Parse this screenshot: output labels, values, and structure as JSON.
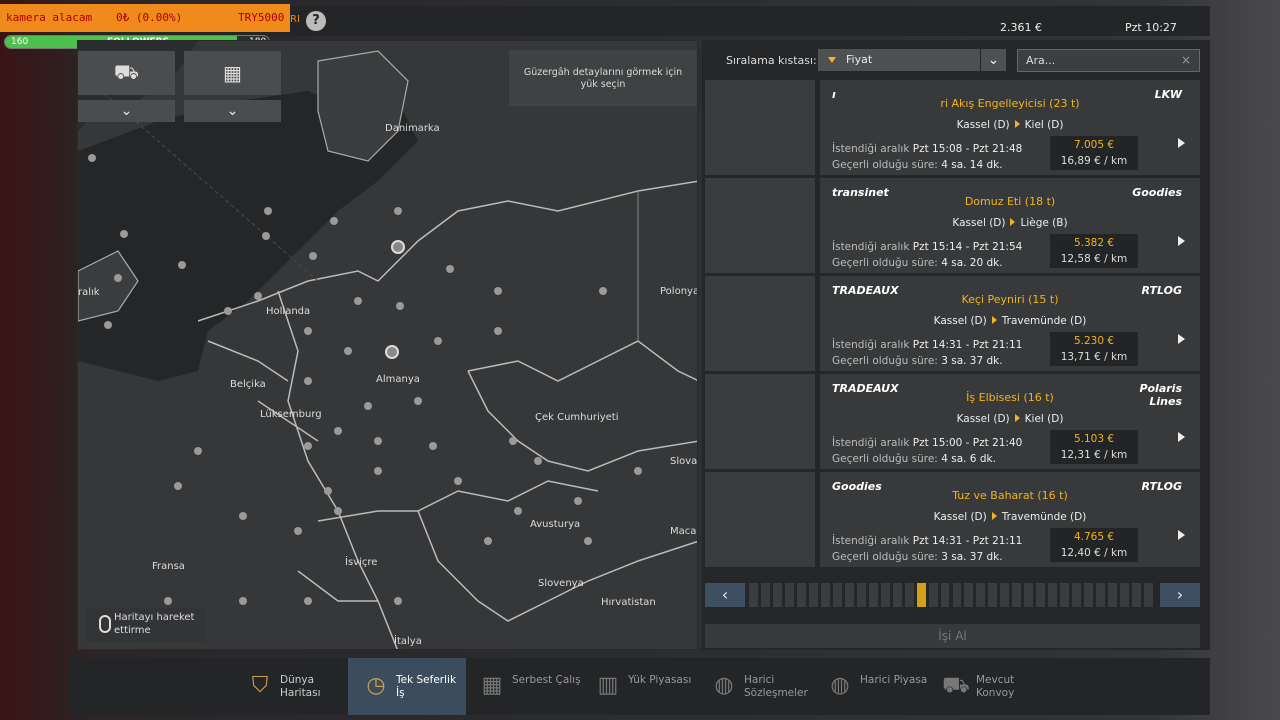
{
  "overlay": {
    "streamer_left": "kamera alacam",
    "streamer_mid": "0₺ (0.00%)",
    "streamer_right": "TRY5000",
    "streamer_suffix": "RI",
    "followers_label": "FOLLOWERS",
    "followers_current": "160",
    "followers_goal": "180",
    "followers_progress": 0.88
  },
  "topbar": {
    "help": "?",
    "money": "2.361 €",
    "clock": "Pzt 10:27"
  },
  "map": {
    "route_hint": "Güzergâh detaylarını görmek için yük seçin",
    "move_hint": "Haritayı hareket ettirme",
    "labels": [
      "Danimarka",
      "ralık",
      "Hollanda",
      "Polonya",
      "Almanya",
      "Belçika",
      "Lüksemburg",
      "Çek Cumhuriyeti",
      "Slova",
      "Avusturya",
      "Macar",
      "Fransa",
      "İsviçre",
      "Slovenya",
      "Hırvatistan",
      "İtalya"
    ]
  },
  "jobs": {
    "sort_label": "Sıralama kıstası:",
    "sort_value": "Fiyat",
    "search_placeholder": "Ara...",
    "req_label": "İstendiği aralık",
    "valid_label": "Geçerli olduğu süre:",
    "accept_label": "İşi Al",
    "items": [
      {
        "logo_left": "ı",
        "logo_right": "LKW",
        "cargo": "ri Akış Engelleyicisi (23 t)",
        "from": "Kassel (D)",
        "to": "Kiel (D)",
        "window": "Pzt 15:08 - Pzt 21:48",
        "valid": "4 sa. 14 dk.",
        "price": "7.005 €",
        "rate": "16,89 € / km"
      },
      {
        "logo_left": "transinet",
        "logo_right": "Goodies",
        "cargo": "Domuz Eti (18 t)",
        "from": "Kassel (D)",
        "to": "Liège (B)",
        "window": "Pzt 15:14 - Pzt 21:54",
        "valid": "4 sa. 20 dk.",
        "price": "5.382 €",
        "rate": "12,58 € / km"
      },
      {
        "logo_left": "TRADEAUX",
        "logo_right": "RTLOG",
        "cargo": "Keçi Peyniri (15 t)",
        "from": "Kassel (D)",
        "to": "Travemünde (D)",
        "window": "Pzt 14:31 - Pzt 21:11",
        "valid": "3 sa. 37 dk.",
        "price": "5.230 €",
        "rate": "13,71 € / km"
      },
      {
        "logo_left": "TRADEAUX",
        "logo_right": "Polaris Lines",
        "cargo": "İş Elbisesi (16 t)",
        "from": "Kassel (D)",
        "to": "Kiel (D)",
        "window": "Pzt 15:00 - Pzt 21:40",
        "valid": "4 sa. 6 dk.",
        "price": "5.103 €",
        "rate": "12,31 € / km"
      },
      {
        "logo_left": "Goodies",
        "logo_right": "RTLOG",
        "cargo": "Tuz ve Baharat (16 t)",
        "from": "Kassel (D)",
        "to": "Travemünde (D)",
        "window": "Pzt 14:31 - Pzt 21:11",
        "valid": "3 sa. 37 dk.",
        "price": "4.765 €",
        "rate": "12,40 € / km"
      }
    ],
    "page_count": 34,
    "current_page": 14
  },
  "nav": {
    "items": [
      {
        "label": "Dünya Haritası",
        "icon": "world-map-icon",
        "state": "normal"
      },
      {
        "label": "Tek Seferlik İş",
        "icon": "stopwatch-icon",
        "state": "active"
      },
      {
        "label": "Serbest Çalış",
        "icon": "freight-market-icon",
        "state": "dim"
      },
      {
        "label": "Yük Piyasası",
        "icon": "cargo-market-icon",
        "state": "dim"
      },
      {
        "label": "Harici Sözleşmeler",
        "icon": "globe-contracts-icon",
        "state": "dim"
      },
      {
        "label": "Harici Piyasa",
        "icon": "globe-market-icon",
        "state": "dim"
      },
      {
        "label": "Mevcut Konvoy",
        "icon": "convoy-icon",
        "state": "dim"
      }
    ]
  }
}
